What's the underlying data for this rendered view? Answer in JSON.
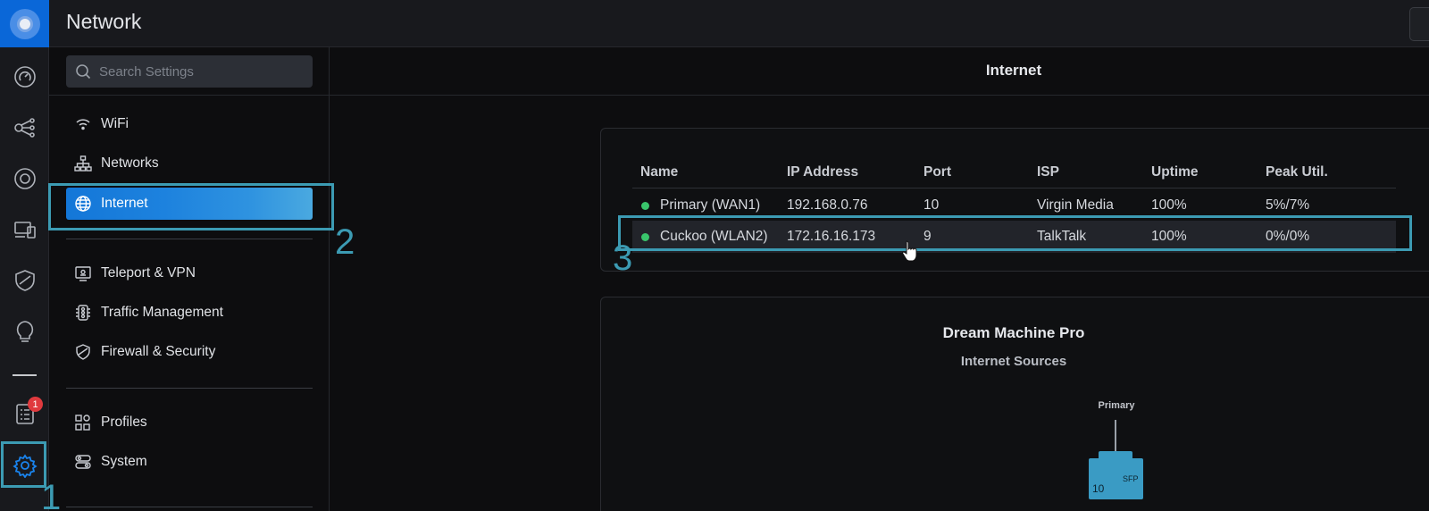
{
  "app": {
    "title": "Network"
  },
  "rail": {
    "icons": [
      "dashboard-icon",
      "topology-icon",
      "devices-icon",
      "clients-icon",
      "shield-icon",
      "insights-icon",
      "alerts-log-icon",
      "settings-icon"
    ],
    "badge_count": "1"
  },
  "search": {
    "placeholder": "Search Settings"
  },
  "nav": {
    "wifi": "WiFi",
    "networks": "Networks",
    "internet": "Internet",
    "teleport": "Teleport & VPN",
    "traffic": "Traffic Management",
    "firewall": "Firewall & Security",
    "profiles": "Profiles",
    "system": "System"
  },
  "main": {
    "title": "Internet",
    "table": {
      "headers": [
        "Name",
        "IP Address",
        "Port",
        "ISP",
        "Uptime",
        "Peak Util."
      ],
      "rows": [
        {
          "name": "Primary (WAN1)",
          "ip": "192.168.0.76",
          "port": "10",
          "isp": "Virgin Media",
          "uptime": "100%",
          "peak": "5%/7%",
          "status": "online"
        },
        {
          "name": "Cuckoo (WLAN2)",
          "ip": "172.16.16.173",
          "port": "9",
          "isp": "TalkTalk",
          "uptime": "100%",
          "peak": "0%/0%",
          "status": "online"
        }
      ]
    },
    "device": {
      "title": "Dream Machine Pro",
      "subtitle": "Internet Sources",
      "wan_label": "Primary",
      "port_number": "10",
      "port_type": "SFP"
    }
  },
  "annotations": {
    "m1": "1",
    "m2": "2",
    "m3": "3"
  },
  "colors": {
    "accent": "#1d82de",
    "highlight": "#3c9bb3",
    "online": "#39c46b",
    "badge": "#e03a3e"
  }
}
